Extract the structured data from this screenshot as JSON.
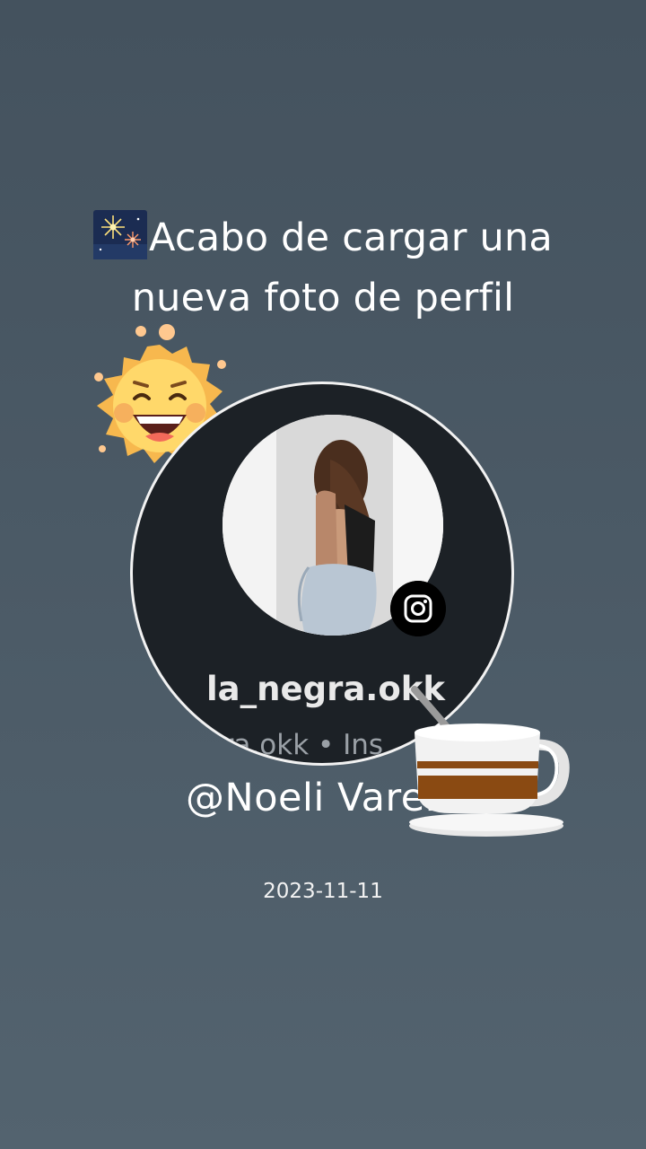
{
  "headline": {
    "icon": "fireworks-icon",
    "line1": "Acabo de cargar una",
    "line2": "nueva foto de perfil"
  },
  "sticker_sun": "smiling-sun-icon",
  "profile_card": {
    "username": "la_negra.okk",
    "subtitle": "gra.okk • Ins",
    "badge_icon": "instagram-icon",
    "border_color": "#f2f2f2"
  },
  "sticker_coffee": "coffee-cup-icon",
  "mention": "@Noeli Varela",
  "date": "2023-11-11"
}
